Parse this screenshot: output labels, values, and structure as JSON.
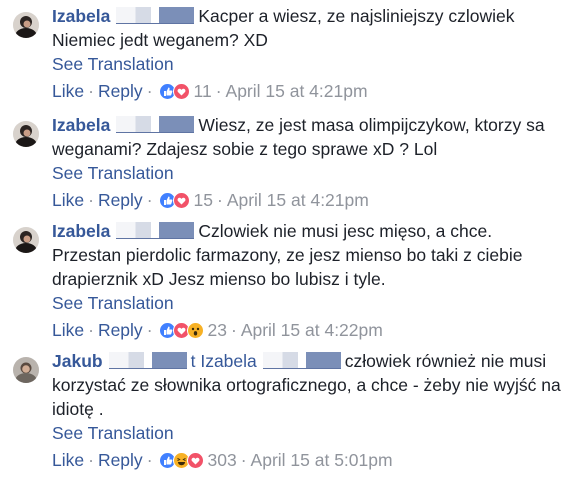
{
  "comments": [
    {
      "name": "Izabela",
      "text": "Kacper a wiesz, ze najsliniejszy czlowiek Niemiec jedt weganem? XD",
      "see_translation": "See Translation",
      "like": "Like",
      "reply": "Reply",
      "reactions": [
        "like",
        "love"
      ],
      "count": "11",
      "time": "April 15 at 4:21pm"
    },
    {
      "name": "Izabela",
      "text": "Wiesz, ze jest masa olimpijczykow, ktorzy sa weganami? Zdajesz sobie z tego sprawe xD ? Lol",
      "see_translation": "See Translation",
      "like": "Like",
      "reply": "Reply",
      "reactions": [
        "like",
        "love"
      ],
      "count": "15",
      "time": "April 15 at 4:21pm"
    },
    {
      "name": "Izabela",
      "text": "Czlowiek nie musi jesc mięso, a chce. Przestan pierdolic farmazony, ze jesz mienso bo taki z ciebie drapierznik xD Jesz mienso bo lubisz i tyle.",
      "see_translation": "See Translation",
      "like": "Like",
      "reply": "Reply",
      "reactions": [
        "like",
        "love",
        "wow"
      ],
      "count": "23",
      "time": "April 15 at 4:22pm"
    },
    {
      "name": "Jakub",
      "mention_suffix": "t",
      "mention": "Izabela",
      "text": "człowiek również nie musi korzystać ze słownika ortograficznego, a chce - żeby nie wyjść na idiotę .",
      "see_translation": "See Translation",
      "like": "Like",
      "reply": "Reply",
      "reactions": [
        "like",
        "haha",
        "love"
      ],
      "count": "303",
      "time": "April 15 at 5:01pm"
    }
  ],
  "colors": {
    "name": "#365899",
    "link": "#365899",
    "meta": "#90949c",
    "text": "#1d2129",
    "like_reaction": "#4080ff",
    "love_reaction": "#f25268",
    "wow_reaction": "#f7b125"
  },
  "icons": [
    "avatar",
    "like-reaction-icon",
    "love-reaction-icon",
    "wow-reaction-icon",
    "haha-reaction-icon"
  ]
}
